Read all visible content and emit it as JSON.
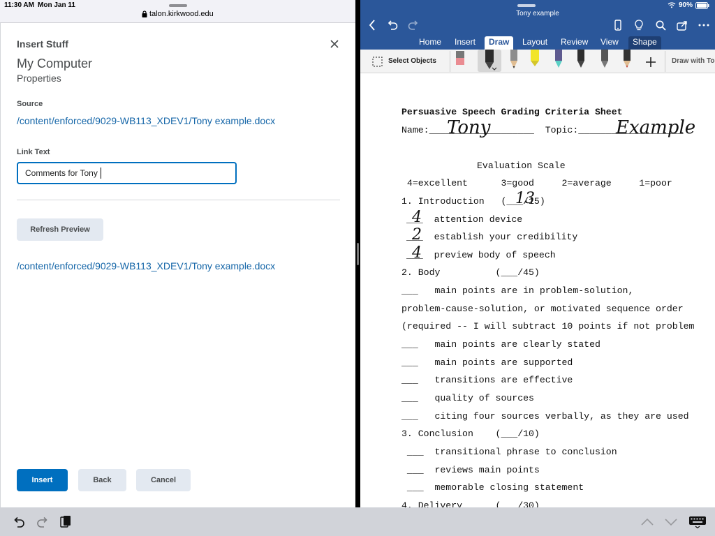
{
  "status_bar": {
    "time": "11:30 AM",
    "date": "Mon Jan 11",
    "url": "talon.kirkwood.edu",
    "battery": "90%"
  },
  "dialog": {
    "title": "Insert Stuff",
    "heading": "My Computer",
    "subheading": "Properties",
    "source_label": "Source",
    "source_link": "/content/enforced/9029-WB113_XDEV1/Tony example.docx",
    "link_text_label": "Link Text",
    "link_text_value": "Comments for Tony",
    "refresh_button": "Refresh Preview",
    "preview_link": "/content/enforced/9029-WB113_XDEV1/Tony example.docx",
    "insert_button": "Insert",
    "back_button": "Back",
    "cancel_button": "Cancel"
  },
  "word": {
    "doc_title": "Tony example",
    "tabs": [
      "Home",
      "Insert",
      "Draw",
      "Layout",
      "Review",
      "View",
      "Shape"
    ],
    "active_tab": "Draw",
    "select_objects": "Select Objects",
    "draw_with": "Draw with To",
    "document": {
      "title": "Persuasive Speech Grading Criteria Sheet",
      "name_line": "Name:___________________  Topic:___________________",
      "name_handwriting": "Tony",
      "topic_handwriting": "Example",
      "scale_heading": "Evaluation Scale",
      "scale_line": " 4=excellent      3=good     2=average     1=poor",
      "intro": "1. Introduction   (___/15)",
      "intro_score": "13",
      "intro_items": [
        "___  attention device",
        "___  establish your credibility",
        "___  preview body of speech"
      ],
      "intro_marks": [
        "4",
        "2",
        "4"
      ],
      "body": "2. Body          (___/45)",
      "body_lines": [
        "___   main points are in problem-solution,",
        "problem-cause-solution, or motivated sequence order",
        "(required -- I will subtract 10 points if not problem",
        "___   main points are clearly stated",
        "___   main points are supported",
        "___   transitions are effective",
        "___   quality of sources",
        "___   citing four sources verbally, as they are used"
      ],
      "conclusion": "3. Conclusion    (___/10)",
      "conclusion_items": [
        " ___  transitional phrase to conclusion",
        " ___  reviews main points",
        " ___  memorable closing statement"
      ],
      "delivery": "4. Delivery      (___/30)"
    }
  }
}
